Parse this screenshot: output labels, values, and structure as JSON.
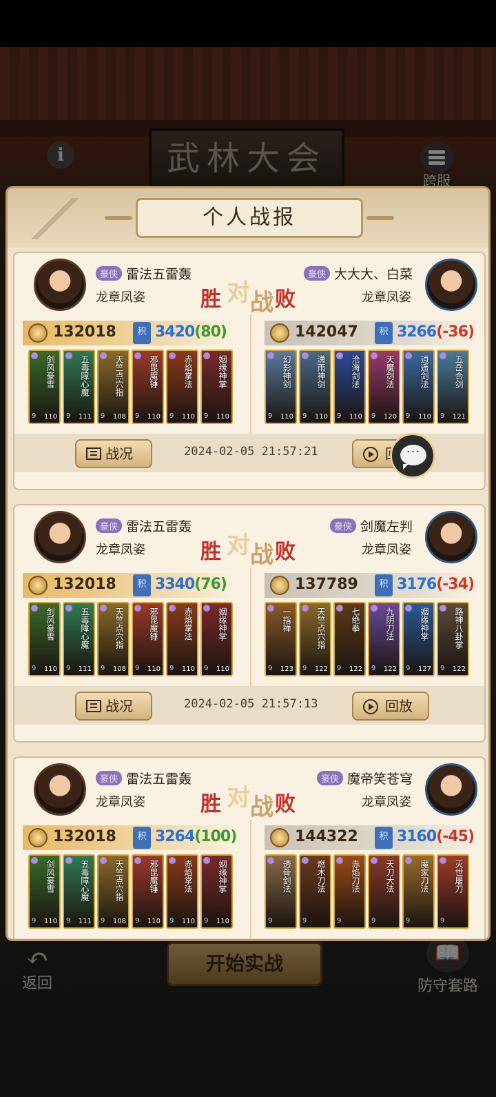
{
  "header": {
    "title": "武林大会",
    "cross_server_label": "跨服"
  },
  "panel": {
    "title": "个人战报"
  },
  "result_labels": {
    "win": "胜",
    "vs1": "对",
    "vs2": "战",
    "lose": "败"
  },
  "buttons": {
    "report": "战况",
    "replay": "回放",
    "back": "返回",
    "start": "开始实战",
    "defense": "防守套路",
    "chat": "···"
  },
  "records": [
    {
      "left": {
        "tag": "豪侠",
        "name": "雷法五雷轰",
        "rank": "龙章凤姿",
        "power": "132018",
        "score": "3420",
        "delta": "(80)",
        "delta_sign": "pos",
        "heroes": [
          {
            "name": "剑风豪雪",
            "level": "110",
            "color": "#3a6a2a"
          },
          {
            "name": "五毒障心魔",
            "level": "111",
            "color": "#2f7a55"
          },
          {
            "name": "天竺点穴指",
            "level": "108",
            "color": "#8a6a2a"
          },
          {
            "name": "邪毘魔锤",
            "level": "110",
            "color": "#9a3a2a"
          },
          {
            "name": "赤焰掌法",
            "level": "110",
            "color": "#8a3a1a"
          },
          {
            "name": "姻缘神掌",
            "level": "110",
            "color": "#7a2a2a"
          }
        ]
      },
      "right": {
        "tag": "豪侠",
        "name": "大大大、白菜",
        "rank": "龙章凤姿",
        "power": "142047",
        "score": "3266",
        "delta": "(-36)",
        "delta_sign": "neg",
        "heroes": [
          {
            "name": "幻影神剑",
            "level": "110",
            "color": "#5a7aa0"
          },
          {
            "name": "潇雨神剑",
            "level": "110",
            "color": "#4a6a8a"
          },
          {
            "name": "沧海剑法",
            "level": "110",
            "color": "#2a4a9a"
          },
          {
            "name": "天魔剑法",
            "level": "120",
            "color": "#9a3a6a"
          },
          {
            "name": "逍遥剑法",
            "level": "110",
            "color": "#3a6aa0"
          },
          {
            "name": "五岳合剑",
            "level": "121",
            "color": "#4a7a9a"
          }
        ]
      },
      "time": "2024-02-05 21:57:21"
    },
    {
      "left": {
        "tag": "豪侠",
        "name": "雷法五雷轰",
        "rank": "龙章凤姿",
        "power": "132018",
        "score": "3340",
        "delta": "(76)",
        "delta_sign": "pos",
        "heroes": [
          {
            "name": "剑风豪雪",
            "level": "110",
            "color": "#3a6a2a"
          },
          {
            "name": "五毒障心魔",
            "level": "111",
            "color": "#2f7a55"
          },
          {
            "name": "天竺点穴指",
            "level": "108",
            "color": "#8a6a2a"
          },
          {
            "name": "邪毘魔锤",
            "level": "110",
            "color": "#9a3a2a"
          },
          {
            "name": "赤焰掌法",
            "level": "110",
            "color": "#8a3a1a"
          },
          {
            "name": "姻缘神掌",
            "level": "110",
            "color": "#7a2a2a"
          }
        ]
      },
      "right": {
        "tag": "豪侠",
        "name": "剑魔左判",
        "rank": "龙章凤姿",
        "power": "137789",
        "score": "3176",
        "delta": "(-34)",
        "delta_sign": "neg",
        "heroes": [
          {
            "name": "一指禅",
            "level": "123",
            "color": "#8a5a2a"
          },
          {
            "name": "天竺点穴指",
            "level": "122",
            "color": "#8a6a2a"
          },
          {
            "name": "七绝拳",
            "level": "122",
            "color": "#5a3a1a"
          },
          {
            "name": "九阴刀法",
            "level": "122",
            "color": "#6a4a9a"
          },
          {
            "name": "姻缘神掌",
            "level": "127",
            "color": "#2a5a9a"
          },
          {
            "name": "路神八卦掌",
            "level": "122",
            "color": "#5a4a3a"
          }
        ]
      },
      "time": "2024-02-05 21:57:13"
    },
    {
      "left": {
        "tag": "豪侠",
        "name": "雷法五雷轰",
        "rank": "龙章凤姿",
        "power": "132018",
        "score": "3264",
        "delta": "(100)",
        "delta_sign": "pos",
        "heroes": [
          {
            "name": "剑风豪雪",
            "level": "110",
            "color": "#3a6a2a"
          },
          {
            "name": "五毒障心魔",
            "level": "111",
            "color": "#2f7a55"
          },
          {
            "name": "天竺点穴指",
            "level": "108",
            "color": "#8a6a2a"
          },
          {
            "name": "邪毘魔锤",
            "level": "110",
            "color": "#9a3a2a"
          },
          {
            "name": "赤焰掌法",
            "level": "110",
            "color": "#8a3a1a"
          },
          {
            "name": "姻缘神掌",
            "level": "110",
            "color": "#7a2a2a"
          }
        ]
      },
      "right": {
        "tag": "豪侠",
        "name": "魔帝笑苍穹",
        "rank": "龙章凤姿",
        "power": "144322",
        "score": "3160",
        "delta": "(-45)",
        "delta_sign": "neg",
        "heroes": [
          {
            "name": "透骨剑法",
            "level": "",
            "color": "#8a6a4a"
          },
          {
            "name": "燃木刀法",
            "level": "",
            "color": "#6a3a1a"
          },
          {
            "name": "赤焰刀法",
            "level": "",
            "color": "#9a4a1a"
          },
          {
            "name": "天刀大法",
            "level": "",
            "color": "#8a3a2a"
          },
          {
            "name": "魔家刀法",
            "level": "",
            "color": "#9a6a2a"
          },
          {
            "name": "灭世屠刀",
            "level": "",
            "color": "#a03a2a"
          }
        ]
      },
      "time": ""
    }
  ]
}
